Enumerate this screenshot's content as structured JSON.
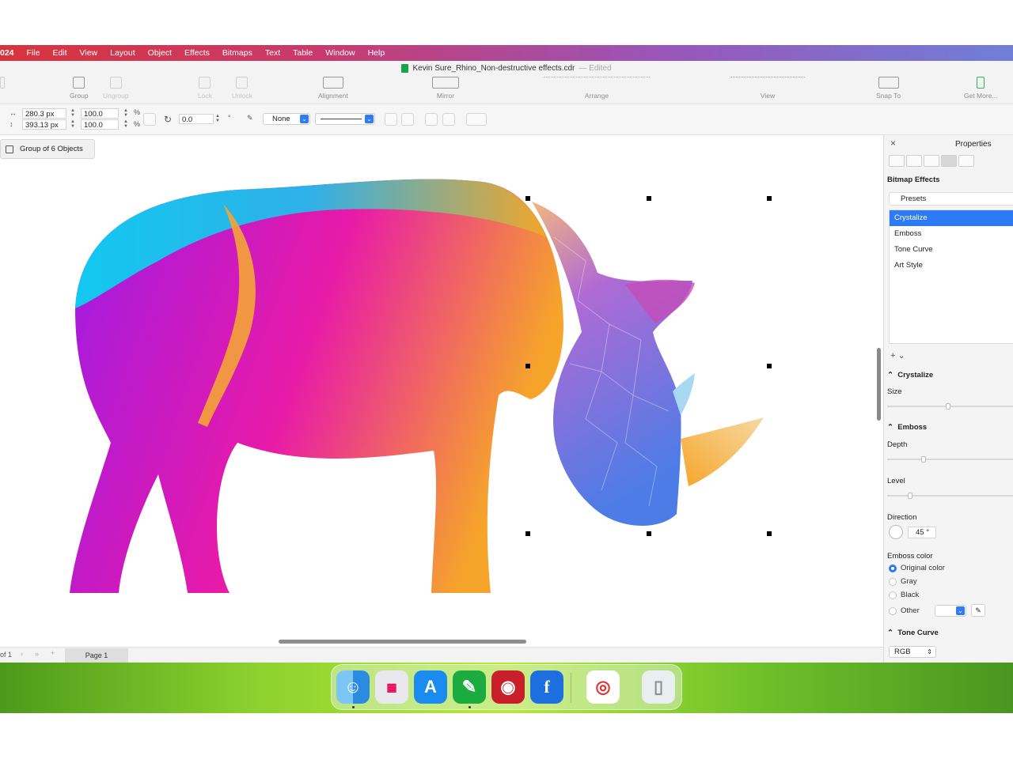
{
  "menubar": {
    "items": [
      "024",
      "File",
      "Edit",
      "View",
      "Layout",
      "Object",
      "Effects",
      "Bitmaps",
      "Text",
      "Table",
      "Window",
      "Help"
    ]
  },
  "titlebar": {
    "filename": "Kevin Sure_Rhino_Non-destructive effects.cdr",
    "status": "— Edited"
  },
  "toolbar": {
    "group": "Group",
    "ungroup": "Ungroup",
    "lock": "Lock",
    "unlock": "Unlock",
    "alignment": "Alignment",
    "mirror": "Mirror",
    "arrange": "Arrange",
    "view": "View",
    "snap_to": "Snap To",
    "get_more": "Get More..."
  },
  "propbar": {
    "width": "280.3 px",
    "height": "393.13 px",
    "scale_x": "100.0",
    "scale_y": "100.0",
    "pct1": "%",
    "pct2": "%",
    "rotation": "0.0",
    "degree": "°",
    "outline": "None"
  },
  "canvas": {
    "selection_label": "Group of 6 Objects",
    "colors": {
      "magenta": "#e81aa8",
      "purple": "#9d1be6",
      "cyan": "#12c8f0",
      "orange": "#f6a52a",
      "blue": "#4d7ce6"
    }
  },
  "pagebar": {
    "page_count": "of 1",
    "page_tab": "Page 1"
  },
  "panel": {
    "title": "Properties",
    "section": "Bitmap Effects",
    "presets": "Presets",
    "effects": [
      "Crystalize",
      "Emboss",
      "Tone Curve",
      "Art Style"
    ],
    "selected_effect": "Crystalize",
    "crystalize": {
      "title": "Crystalize",
      "size_label": "Size",
      "size_level": 0.48
    },
    "emboss": {
      "title": "Emboss",
      "depth_label": "Depth",
      "depth_level": 0.28,
      "level_label": "Level",
      "level_level": 0.17,
      "direction_label": "Direction",
      "direction_value": "45 °",
      "color_label": "Emboss color",
      "options": [
        "Original color",
        "Gray",
        "Black",
        "Other"
      ],
      "selected": "Original color"
    },
    "tone_curve": {
      "title": "Tone Curve",
      "channel": "RGB"
    }
  },
  "dock": {
    "apps": [
      "finder-icon",
      "launchpad-icon",
      "app-store-icon",
      "coreldraw-icon",
      "photo-booth-icon",
      "facebook-icon",
      "chrome-icon",
      "trash-icon"
    ]
  }
}
